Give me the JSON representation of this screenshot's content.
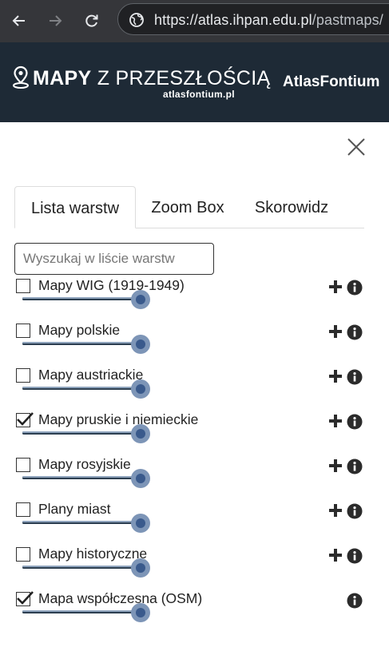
{
  "browser": {
    "url_host": "https://atlas.ihpan.edu.pl",
    "url_path": "/pastmaps/"
  },
  "header": {
    "logo_bold": "MAPY",
    "logo_rest": "Z PRZESZŁOŚCIĄ",
    "logo_sub": "atlasfontium.pl",
    "brand": "AtlasFontium"
  },
  "tabs": [
    {
      "label": "Lista warstw"
    },
    {
      "label": "Zoom Box"
    },
    {
      "label": "Skorowidz"
    }
  ],
  "search": {
    "placeholder": "Wyszukaj w liście warstw",
    "value": ""
  },
  "layers": [
    {
      "name": "Mapy WIG (1919-1949)",
      "checked": false,
      "opacity": 1
    },
    {
      "name": "Mapy polskie",
      "checked": false,
      "opacity": 1
    },
    {
      "name": "Mapy austriackie",
      "checked": false,
      "opacity": 1
    },
    {
      "name": "Mapy pruskie i niemieckie",
      "checked": true,
      "opacity": 1
    },
    {
      "name": "Mapy rosyjskie",
      "checked": false,
      "opacity": 1
    },
    {
      "name": "Plany miast",
      "checked": false,
      "opacity": 1
    },
    {
      "name": "Mapy historyczne",
      "checked": false,
      "opacity": 1
    },
    {
      "name": "Mapa współczesna (OSM)",
      "checked": true,
      "opacity": 1
    }
  ],
  "icons": {
    "back": "back-arrow-icon",
    "forward": "forward-arrow-icon",
    "reload": "reload-icon",
    "site_info": "site-settings-icon",
    "logo": "map-pin-icon",
    "close": "close-icon",
    "add": "plus-icon",
    "info": "info-icon"
  },
  "colors": {
    "header_bg": "#1e2a36",
    "browser_bg": "#35363a",
    "slider_thumb": "#7d95b7"
  }
}
